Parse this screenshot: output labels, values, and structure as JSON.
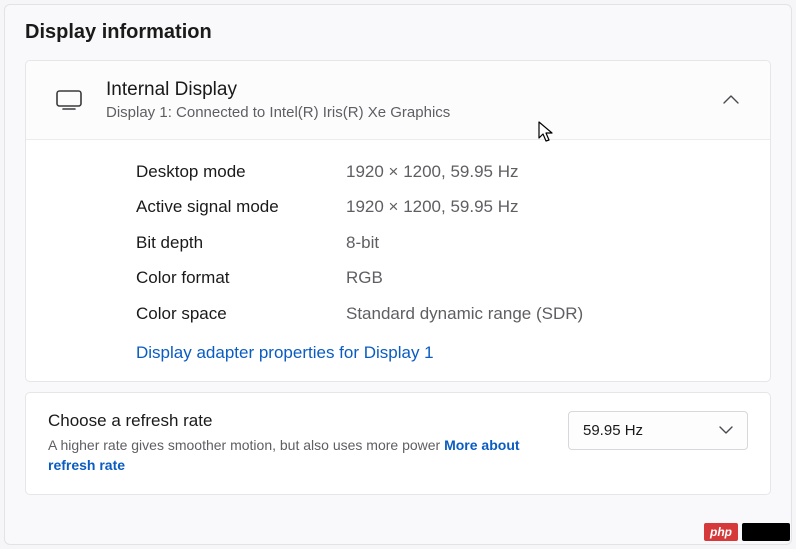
{
  "section_title": "Display information",
  "display": {
    "title": "Internal Display",
    "subtitle": "Display 1: Connected to Intel(R) Iris(R) Xe Graphics",
    "props": [
      {
        "label": "Desktop mode",
        "value": "1920 × 1200, 59.95 Hz"
      },
      {
        "label": "Active signal mode",
        "value": "1920 × 1200, 59.95 Hz"
      },
      {
        "label": "Bit depth",
        "value": "8-bit"
      },
      {
        "label": "Color format",
        "value": "RGB"
      },
      {
        "label": "Color space",
        "value": "Standard dynamic range (SDR)"
      }
    ],
    "adapter_link": "Display adapter properties for Display 1"
  },
  "refresh": {
    "title": "Choose a refresh rate",
    "desc_prefix": "A higher rate gives smoother motion, but also uses more power  ",
    "more_link": "More about refresh rate",
    "selected": "59.95 Hz"
  },
  "watermark": "php"
}
